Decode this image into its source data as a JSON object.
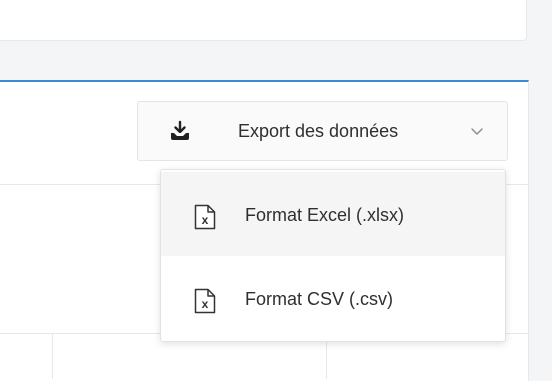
{
  "toolbar": {
    "export_label": "Export des données",
    "icons": {
      "export": "download-tray-icon",
      "dropdown": "chevron-down-icon"
    }
  },
  "menu": {
    "items": [
      {
        "label": "Format Excel (.xlsx)",
        "icon": "excel-file-icon"
      },
      {
        "label": "Format CSV (.csv)",
        "icon": "csv-file-icon"
      }
    ]
  },
  "colors": {
    "accent_border": "#3d8bd4",
    "menu_hover": "#f5f5f5",
    "text": "#2f2f2f"
  }
}
